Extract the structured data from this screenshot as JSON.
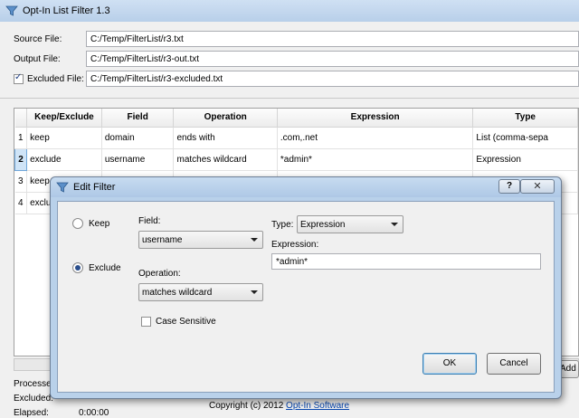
{
  "main": {
    "title": "Opt-In List Filter 1.3",
    "source_label": "Source File:",
    "source_value": "C:/Temp/FilterList/r3.txt",
    "output_label": "Output File:",
    "output_value": "C:/Temp/FilterList/r3-out.txt",
    "excluded_label": "Excluded File:",
    "excluded_value": "C:/Temp/FilterList/r3-excluded.txt",
    "excluded_checked": true,
    "add_button": "Add"
  },
  "table": {
    "columns": [
      "Keep/Exclude",
      "Field",
      "Operation",
      "Expression",
      "Type"
    ],
    "rows": [
      {
        "num": "1",
        "keep": "keep",
        "field": "domain",
        "operation": "ends with",
        "expression": ".com,.net",
        "type": "List (comma-sepa"
      },
      {
        "num": "2",
        "keep": "exclude",
        "field": "username",
        "operation": "matches wildcard",
        "expression": "*admin*",
        "type": "Expression"
      },
      {
        "num": "3",
        "keep": "keep",
        "field": "",
        "operation": "",
        "expression": "",
        "type": ""
      },
      {
        "num": "4",
        "keep": "exclu",
        "field": "",
        "operation": "",
        "expression": "",
        "type": ""
      }
    ]
  },
  "status": {
    "processed_label": "Processed",
    "excluded_label": "Excluded:",
    "elapsed_label": "Elapsed:",
    "elapsed_value": "0:00:00"
  },
  "footer": {
    "copyright_text": "Copyright (c) 2012",
    "link_text": "Opt-In Software"
  },
  "dialog": {
    "title": "Edit Filter",
    "help_label": "?",
    "close_label": "✕",
    "keep_label": "Keep",
    "exclude_label": "Exclude",
    "selected": "Exclude",
    "field_label": "Field:",
    "field_value": "username",
    "operation_label": "Operation:",
    "operation_value": "matches wildcard",
    "case_sensitive_label": "Case Sensitive",
    "case_sensitive": false,
    "type_label": "Type:",
    "type_value": "Expression",
    "expression_label": "Expression:",
    "expression_value": "*admin*",
    "ok_label": "OK",
    "cancel_label": "Cancel"
  }
}
